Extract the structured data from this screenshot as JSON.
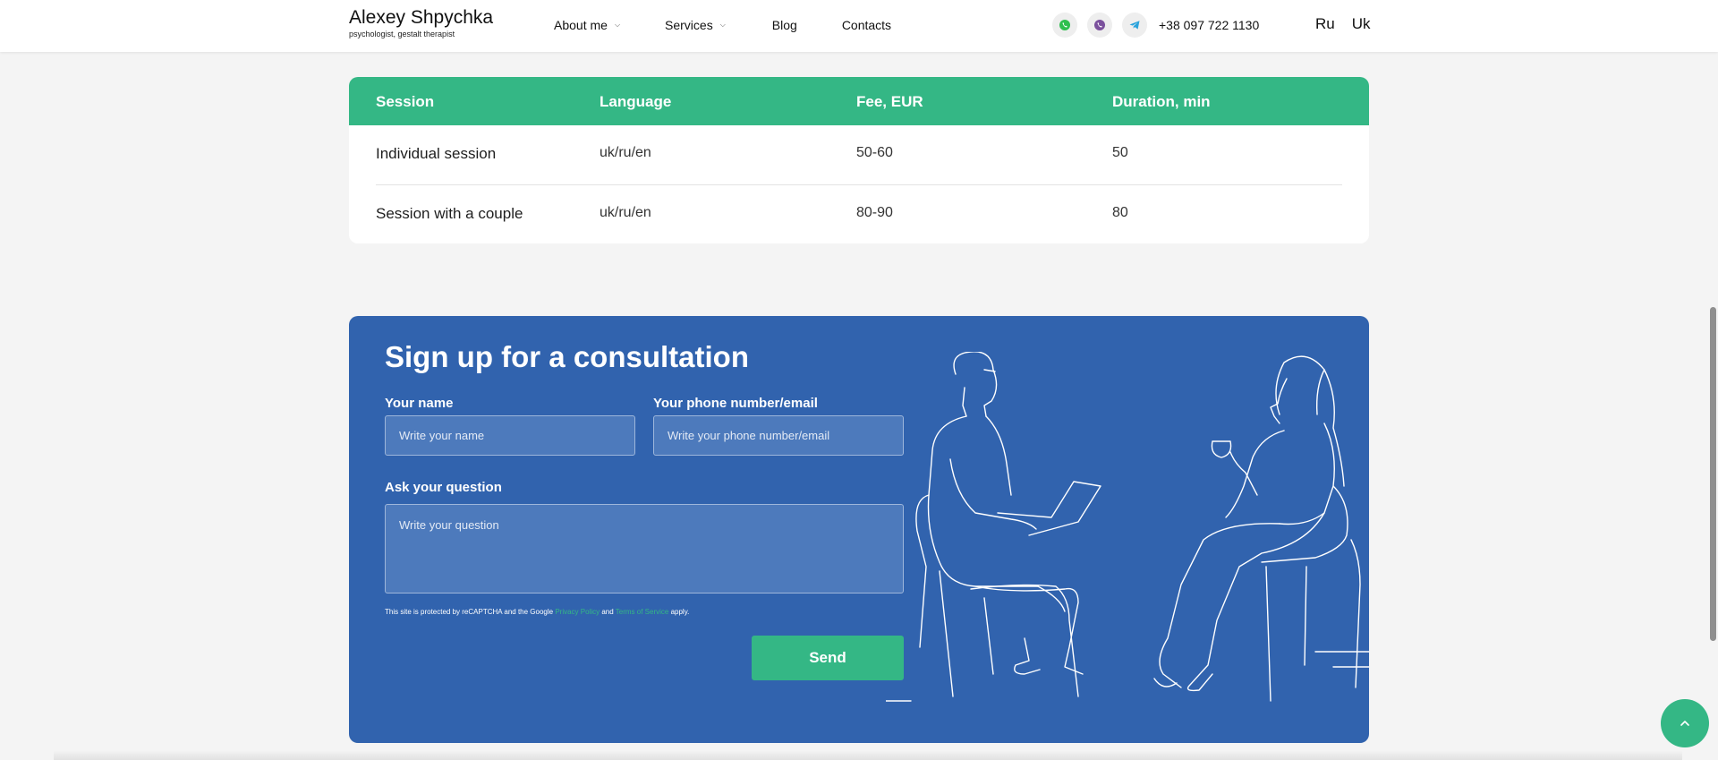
{
  "header": {
    "logo_name": "Alexey Shpychka",
    "logo_subtitle": "psychologist, gestalt therapist",
    "nav": [
      {
        "label": "About me",
        "has_dropdown": true
      },
      {
        "label": "Services",
        "has_dropdown": true
      },
      {
        "label": "Blog",
        "has_dropdown": false
      },
      {
        "label": "Contacts",
        "has_dropdown": false
      }
    ],
    "social_icons": [
      "whatsapp-icon",
      "viber-icon",
      "telegram-icon"
    ],
    "phone": "+38 097 722 1130",
    "languages": [
      "Ru",
      "Uk"
    ]
  },
  "pricing": {
    "headers": [
      "Session",
      "Language",
      "Fee, EUR",
      "Duration, min"
    ],
    "rows": [
      {
        "session": "Individual session",
        "language": "uk/ru/en",
        "fee": "50-60",
        "duration": "50"
      },
      {
        "session": "Session with a couple",
        "language": "uk/ru/en",
        "fee": "80-90",
        "duration": "80"
      }
    ]
  },
  "form": {
    "title": "Sign up for a consultation",
    "name_label": "Your name",
    "name_placeholder": "Write your name",
    "contact_label": "Your phone number/email",
    "contact_placeholder": "Write your phone number/email",
    "question_label": "Ask your question",
    "question_placeholder": "Write your question",
    "recaptcha_prefix": "This site is protected by reCAPTCHA and the Google ",
    "privacy_link": "Privacy Policy",
    "recaptcha_and": " and ",
    "terms_link": "Terms of Service",
    "recaptcha_suffix": " apply.",
    "send_label": "Send"
  },
  "colors": {
    "accent_green": "#34b785",
    "form_blue": "#3163ae",
    "background": "#f4f4f4"
  },
  "icons": {
    "back_to_top": "chevron-up-icon",
    "illustration": "therapy-session-line-illustration"
  }
}
